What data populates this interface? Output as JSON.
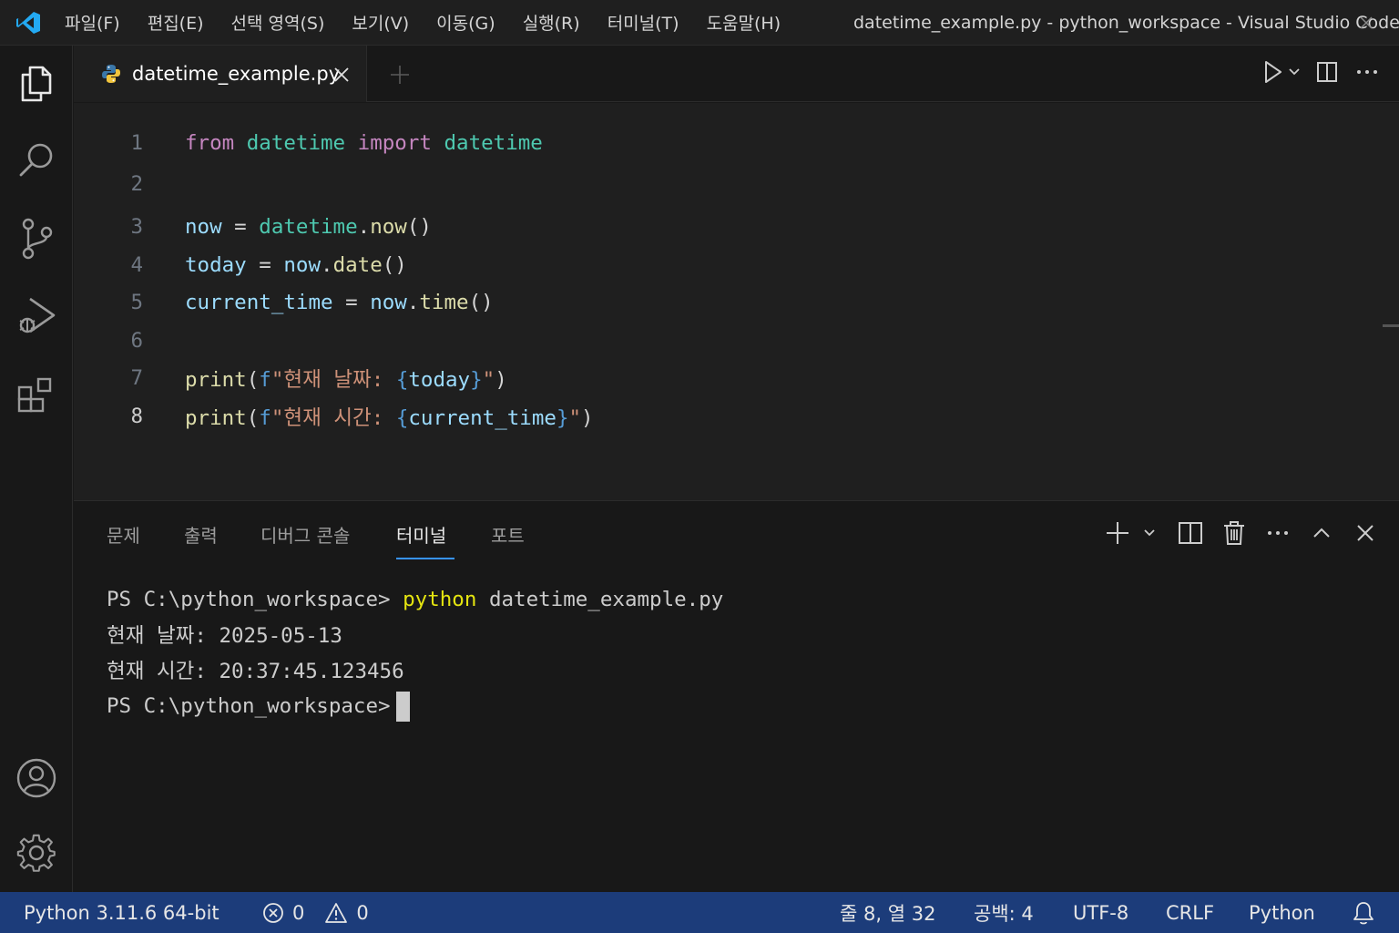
{
  "menu": [
    "파일(F)",
    "편집(E)",
    "선택 영역(S)",
    "보기(V)",
    "이동(G)",
    "실행(R)",
    "터미널(T)",
    "도움말(H)"
  ],
  "window_title": "datetime_example.py - python_workspace - Visual Studio Code",
  "tab": {
    "label": "datetime_example.py"
  },
  "editor": {
    "line_numbers": [
      "1",
      "2",
      "3",
      "4",
      "5",
      "6",
      "7",
      "8"
    ],
    "current_line": "8",
    "tokens": {
      "l1_from": "from",
      "l1_mod": "datetime",
      "l1_import": "import",
      "l1_cls": "datetime",
      "l3_var": "now",
      "l3_eq": " = ",
      "l3_cls": "datetime",
      "l3_dot": ".",
      "l3_fn": "now",
      "l3_paren": "()",
      "l4_var": "today",
      "l4_eq": " = ",
      "l4_obj": "now",
      "l4_dot": ".",
      "l4_fn": "date",
      "l4_paren": "()",
      "l5_var": "current_time",
      "l5_eq": " = ",
      "l5_obj": "now",
      "l5_dot": ".",
      "l5_fn": "time",
      "l5_paren": "()",
      "l7_fn": "print",
      "l7_open": "(",
      "l7_f": "f",
      "l7_str": "\"현재 날짜: ",
      "l7_lb": "{",
      "l7_var": "today",
      "l7_rb": "}",
      "l7_end": "\"",
      "l7_close": ")",
      "l8_fn": "print",
      "l8_open": "(",
      "l8_f": "f",
      "l8_str": "\"현재 시간: ",
      "l8_lb": "{",
      "l8_var": "current_time",
      "l8_rb": "}",
      "l8_end": "\"",
      "l8_close": ")"
    }
  },
  "panel": {
    "tabs": [
      "문제",
      "출력",
      "디버그 콘솔",
      "터미널",
      "포트"
    ],
    "active_tab": "터미널",
    "terminal": {
      "prompt": "PS C:\\python_workspace>",
      "command": "python",
      "command_arg": "datetime_example.py",
      "output_1": "현재 날짜: 2025-05-13",
      "output_2": "현재 시간: 20:37:45.123456",
      "prompt_2": "PS C:\\python_workspace>"
    }
  },
  "statusbar": {
    "interpreter": "Python  3.11.6 64-bit",
    "errors": "0",
    "warnings": "0",
    "position": "줄 8, 열 32",
    "spaces": "공백: 4",
    "encoding": "UTF-8",
    "eol": "CRLF",
    "language": "Python"
  },
  "colors": {
    "accent": "#3794ff",
    "statusbar_bg": "#1c3c7a",
    "vscode_blue": "#23a9f2"
  },
  "icons": {
    "activity": [
      "explorer-icon",
      "search-icon",
      "source-control-icon",
      "run-debug-icon",
      "extensions-icon",
      "account-icon",
      "gear-icon"
    ]
  }
}
